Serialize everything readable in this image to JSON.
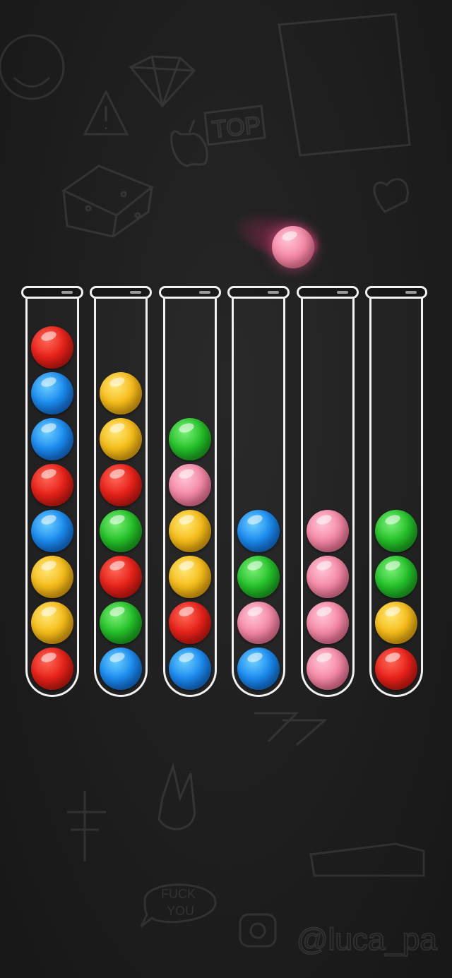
{
  "game": {
    "type": "ball-sort-puzzle",
    "tube_capacity": 8,
    "held_ball": "pink",
    "tubes": [
      {
        "id": 1,
        "balls_top_to_bottom": [
          "red",
          "blue",
          "blue",
          "red",
          "blue",
          "yellow",
          "yellow",
          "red"
        ]
      },
      {
        "id": 2,
        "balls_top_to_bottom": [
          "yellow",
          "yellow",
          "red",
          "green",
          "red",
          "green",
          "blue"
        ]
      },
      {
        "id": 3,
        "balls_top_to_bottom": [
          "green",
          "pink",
          "yellow",
          "yellow",
          "red",
          "blue"
        ]
      },
      {
        "id": 4,
        "balls_top_to_bottom": [
          "blue",
          "green",
          "pink",
          "blue"
        ]
      },
      {
        "id": 5,
        "balls_top_to_bottom": [
          "pink",
          "pink",
          "pink",
          "pink"
        ]
      },
      {
        "id": 6,
        "balls_top_to_bottom": [
          "green",
          "green",
          "yellow",
          "red"
        ]
      }
    ]
  },
  "colors": {
    "background": "#1e1e1e",
    "tube_outline": "#f2f2f2",
    "red": "#e8221a",
    "blue": "#1c8cf0",
    "yellow": "#f6bd1a",
    "green": "#25c22a",
    "pink": "#f58aa8"
  },
  "background_doodles": {
    "texts": [
      "TOP",
      "FUCK",
      "YOU",
      "@luca_pa"
    ]
  }
}
